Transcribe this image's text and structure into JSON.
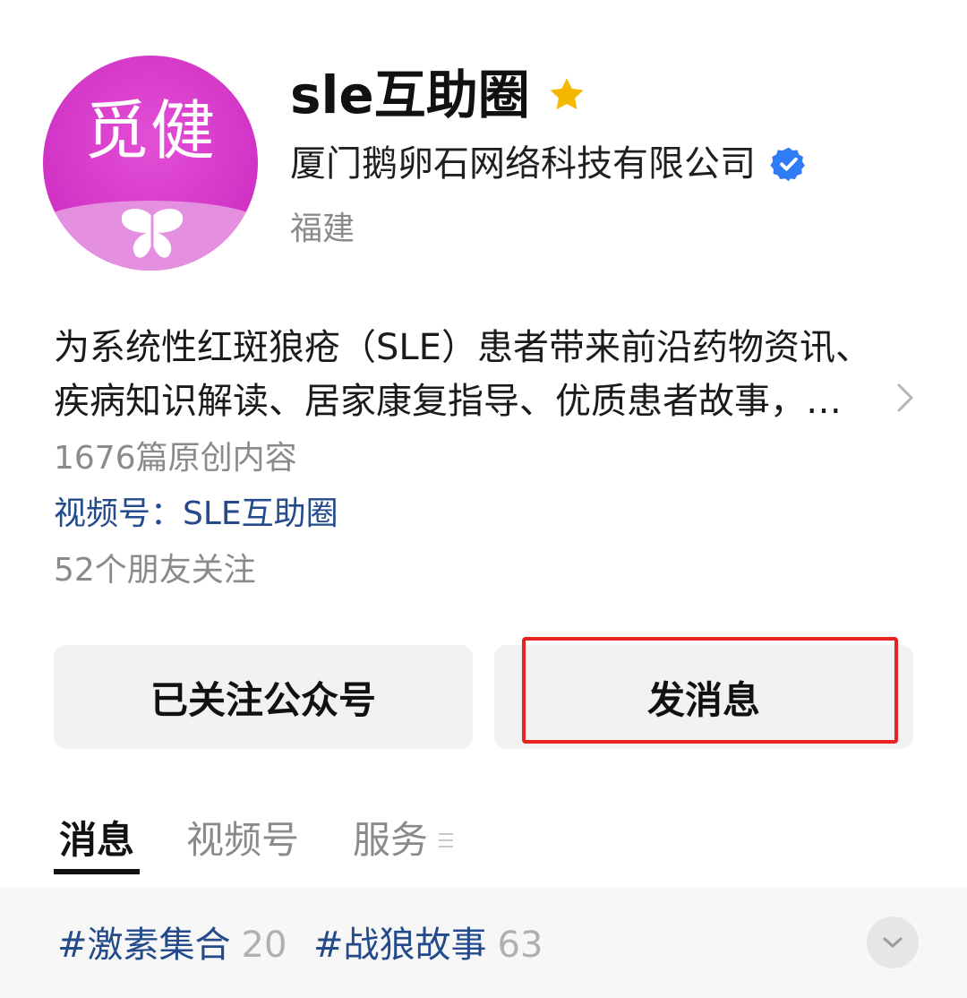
{
  "account": {
    "avatar_text": "觅健",
    "title": "sle互助圈",
    "company": "厦门鹅卵石网络科技有限公司",
    "region": "福建",
    "description_line1": "为系统性红斑狼疮（SLE）患者带来前沿药物资讯、",
    "description_line2": "疾病知识解读、居家康复指导、优质患者故事，…",
    "original_count": "1676篇原创内容",
    "channel": "视频号：SLE互助圈",
    "friends_follow": "52个朋友关注"
  },
  "actions": {
    "follow_label": "已关注公众号",
    "message_label": "发消息"
  },
  "tabs": [
    {
      "label": "消息",
      "active": true
    },
    {
      "label": "视频号",
      "active": false
    },
    {
      "label": "服务",
      "active": false
    }
  ],
  "tags": [
    {
      "name": "#激素集合",
      "count": "20"
    },
    {
      "name": "#战狼故事",
      "count": "63"
    }
  ],
  "colors": {
    "avatar": "#d032c4",
    "link": "#234a8a",
    "star": "#f5b800",
    "verified": "#2f7cf6",
    "highlight": "#e8231f"
  },
  "icons": [
    "star-icon",
    "verified-icon",
    "chevron-right-icon",
    "menu-icon",
    "chevron-down-icon",
    "butterfly-icon"
  ]
}
